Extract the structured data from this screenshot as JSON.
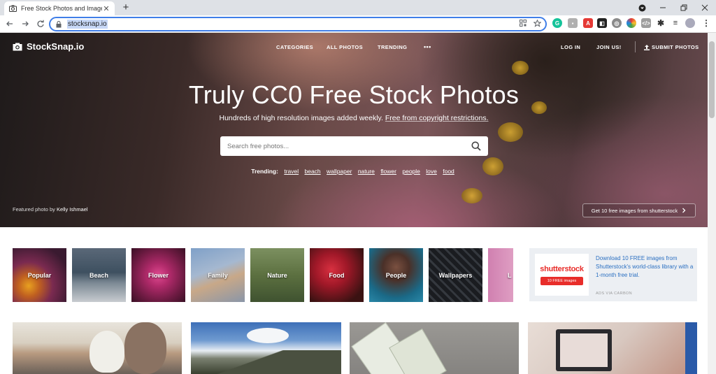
{
  "browser": {
    "tab_title": "Free Stock Photos and Images",
    "tab_close": "✕",
    "new_tab": "+",
    "url": "stocksnap.io"
  },
  "site": {
    "logo": "StockSnap.io",
    "nav": {
      "categories": "CATEGORIES",
      "all_photos": "ALL PHOTOS",
      "trending": "TRENDING",
      "more": "•••",
      "login": "LOG IN",
      "join": "JOIN US!",
      "submit": "SUBMIT PHOTOS"
    },
    "hero": {
      "title": "Truly CC0 Free Stock Photos",
      "subtitle_plain": "Hundreds of high resolution images added weekly. ",
      "subtitle_link": "Free from copyright restrictions.",
      "search_placeholder": "Search free photos...",
      "trending_label": "Trending:",
      "trending": [
        "travel",
        "beach",
        "wallpaper",
        "nature",
        "flower",
        "people",
        "love",
        "food"
      ],
      "credit_prefix": "Featured photo by ",
      "credit_name": "Kelly Ishmael",
      "promo": "Get 10 free images from shutterstock"
    },
    "categories": [
      "Popular",
      "Beach",
      "Flower",
      "Family",
      "Nature",
      "Food",
      "People",
      "Wallpapers",
      "L"
    ],
    "ad": {
      "logo": "shutterstock",
      "button": "10 FREE images",
      "text": "Download 10 FREE images from Shutterstock's world-class library with a 1-month free trial.",
      "small": "ADS VIA CARBON"
    }
  },
  "colors": {
    "accent": "#3f7ee8",
    "brand_red": "#e82d2a",
    "link_blue": "#2a6fc1"
  }
}
